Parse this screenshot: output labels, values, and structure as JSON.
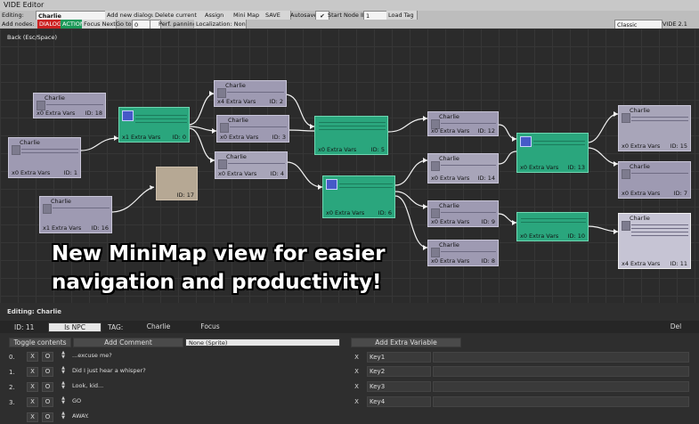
{
  "window": {
    "title": "VIDE Editor",
    "version": "VIDE 2.1"
  },
  "toolbar": {
    "editing_label": "Editing:",
    "current_file": "Charlie",
    "add_new_dialogue": "Add new dialogue",
    "delete_current": "Delete current",
    "assign": "Assign",
    "mini_map": "Mini Map",
    "save": "SAVE",
    "autosave": "Autosave",
    "autosave_checked": "✔",
    "start_node_id_label": "Start Node ID:",
    "start_node_id_value": "1",
    "load_tag": "Load Tag",
    "font_label": "Classic"
  },
  "toolbar2": {
    "add_nodes": "Add nodes:",
    "dialog_tag": "DIALOG",
    "action_tag": "ACTION",
    "focus_next": "Focus Next",
    "go_to": "Go to:",
    "go_to_value": "0",
    "perf_panning": "Perf. panning",
    "localization": "Localization: None"
  },
  "canvas": {
    "back_label": "Back (Esc/Space)",
    "promo_line1": "New MiniMap view for easier",
    "promo_line2": "navigation and productivity!"
  },
  "nodes": {
    "n18": {
      "name": "Charlie",
      "extra": "x0 Extra Vars",
      "id": "ID: 18"
    },
    "n1": {
      "name": "Charlie",
      "extra": "x0 Extra Vars",
      "id": "ID: 1"
    },
    "n16": {
      "name": "Charlie",
      "extra": "x1 Extra Vars",
      "id": "ID: 16"
    },
    "n0": {
      "extra": "x1 Extra Vars",
      "id": "ID: 0"
    },
    "n17": {
      "id": "ID: 17"
    },
    "n2": {
      "name": "Charlie",
      "extra": "x4 Extra Vars",
      "id": "ID: 2"
    },
    "n3": {
      "name": "Charlie",
      "extra": "x0 Extra Vars",
      "id": "ID: 3"
    },
    "n4": {
      "name": "Charlie",
      "extra": "x0 Extra Vars",
      "id": "ID: 4"
    },
    "n5": {
      "extra": "x0 Extra Vars",
      "id": "ID: 5"
    },
    "n6": {
      "extra": "x0 Extra Vars",
      "id": "ID: 6"
    },
    "n12": {
      "name": "Charlie",
      "extra": "x0 Extra Vars",
      "id": "ID: 12"
    },
    "n14": {
      "name": "Charlie",
      "extra": "x0 Extra Vars",
      "id": "ID: 14"
    },
    "n9": {
      "name": "Charlie",
      "extra": "x0 Extra Vars",
      "id": "ID: 9"
    },
    "n8": {
      "name": "Charlie",
      "extra": "x0 Extra Vars",
      "id": "ID: 8"
    },
    "n13": {
      "extra": "x0 Extra Vars",
      "id": "ID: 13"
    },
    "n10": {
      "extra": "x0 Extra Vars",
      "id": "ID: 10"
    },
    "n15": {
      "name": "Charlie",
      "extra": "x0 Extra Vars",
      "id": "ID: 15"
    },
    "n7": {
      "name": "Charlie",
      "extra": "x0 Extra Vars",
      "id": "ID: 7"
    },
    "n11": {
      "name": "Charlie",
      "extra": "x4 Extra Vars",
      "id": "ID: 11"
    }
  },
  "editor": {
    "editing_title": "Editing: Charlie",
    "id_label": "ID: 11",
    "is_npc": "Is NPC",
    "tag_label": "TAG:",
    "tag_value": "Charlie",
    "focus": "Focus",
    "del": "Del",
    "toggle_contents": "Toggle contents",
    "add_comment": "Add Comment",
    "sprite_field": "None (Sprite)",
    "add_extra_variable": "Add Extra Variable",
    "rows": [
      {
        "num": "0.",
        "x": "X",
        "o": "O",
        "text": "...excuse me?"
      },
      {
        "num": "1.",
        "x": "X",
        "o": "O",
        "text": "Did I just hear a whisper?"
      },
      {
        "num": "2.",
        "x": "X",
        "o": "O",
        "text": "Look, kid..."
      },
      {
        "num": "3.",
        "x": "X",
        "o": "O",
        "text": "GO"
      },
      {
        "num": "",
        "x": "X",
        "o": "O",
        "text": "AWAY."
      }
    ],
    "keys": [
      {
        "x": "X",
        "key": "Key1"
      },
      {
        "x": "X",
        "key": "Key2"
      },
      {
        "x": "X",
        "key": "Key3"
      },
      {
        "x": "X",
        "key": "Key4"
      }
    ]
  }
}
